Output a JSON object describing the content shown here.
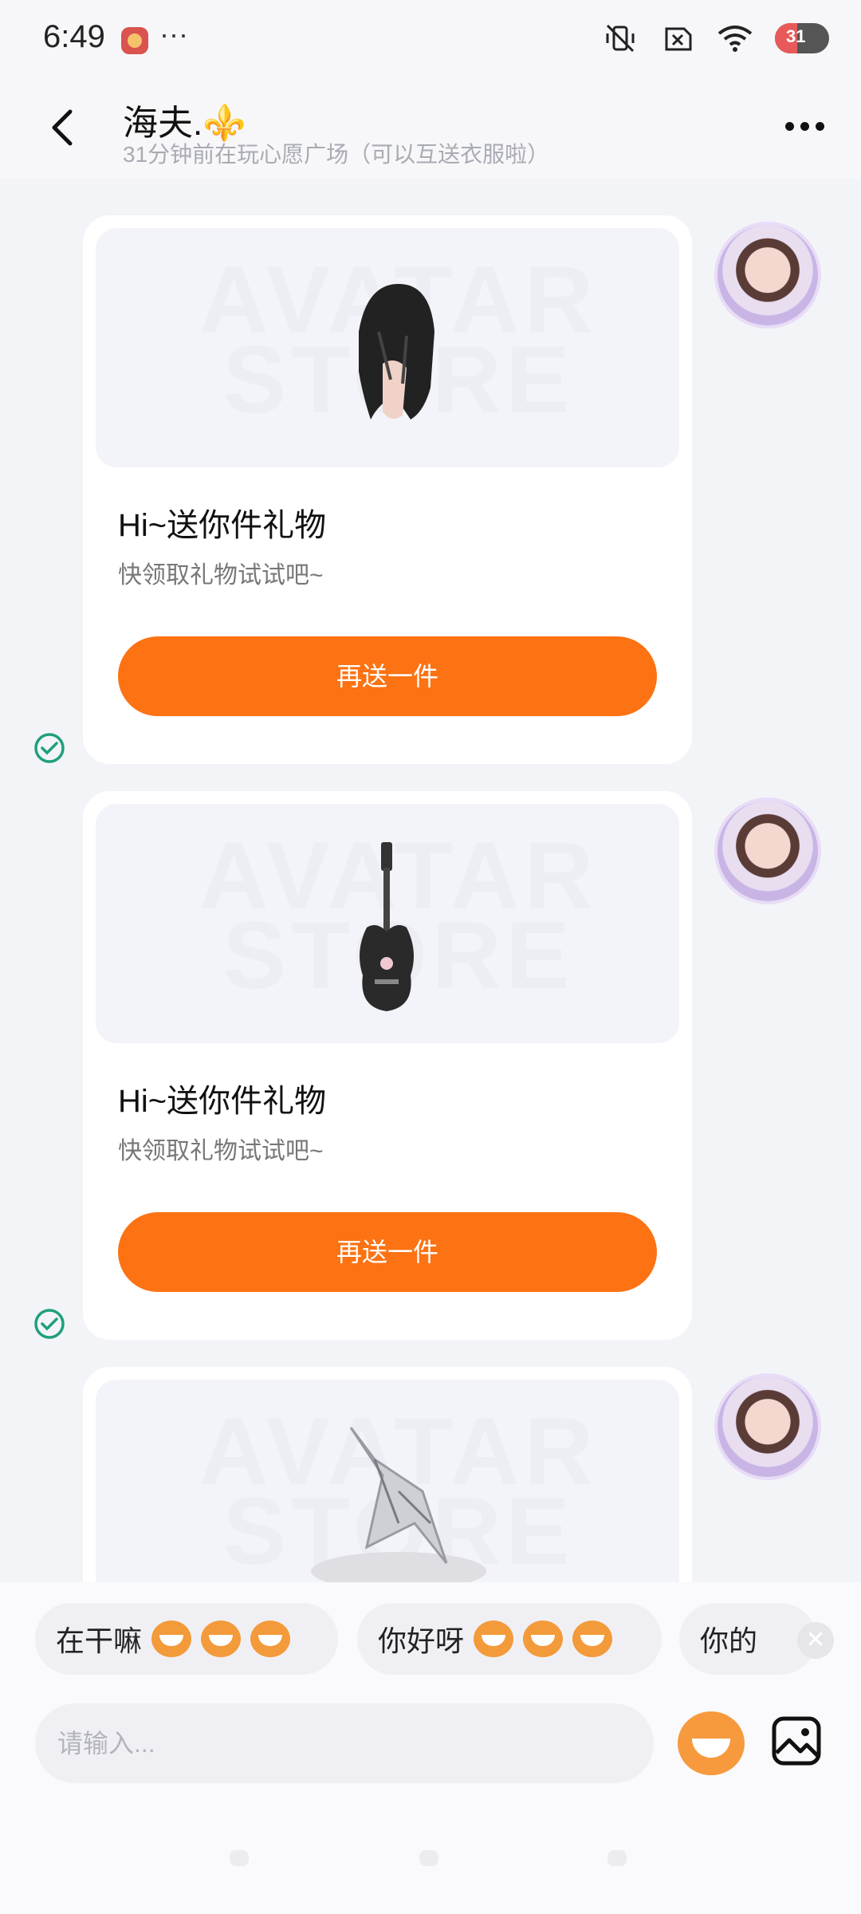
{
  "status": {
    "time": "6:49",
    "dots": "···",
    "battery": "31"
  },
  "header": {
    "title": "海夫.⚜️",
    "subtitle": "31分钟前在玩心愿广场（可以互送衣服啦）"
  },
  "cards": [
    {
      "watermark": "AVATAR STORE",
      "title": "Hi~送你件礼物",
      "desc": "快领取礼物试试吧~",
      "button": "再送一件",
      "item_icon": "hair-icon"
    },
    {
      "watermark": "AVATAR STORE",
      "title": "Hi~送你件礼物",
      "desc": "快领取礼物试试吧~",
      "button": "再送一件",
      "item_icon": "guitar-icon"
    },
    {
      "watermark": "AVATAR STORE",
      "item_icon": "crystal-item-icon"
    }
  ],
  "quick_replies": [
    "在干嘛",
    "你好呀",
    "你的"
  ],
  "input": {
    "placeholder": "请输入..."
  },
  "colors": {
    "accent": "#fd7212",
    "check": "#1ea07a"
  }
}
